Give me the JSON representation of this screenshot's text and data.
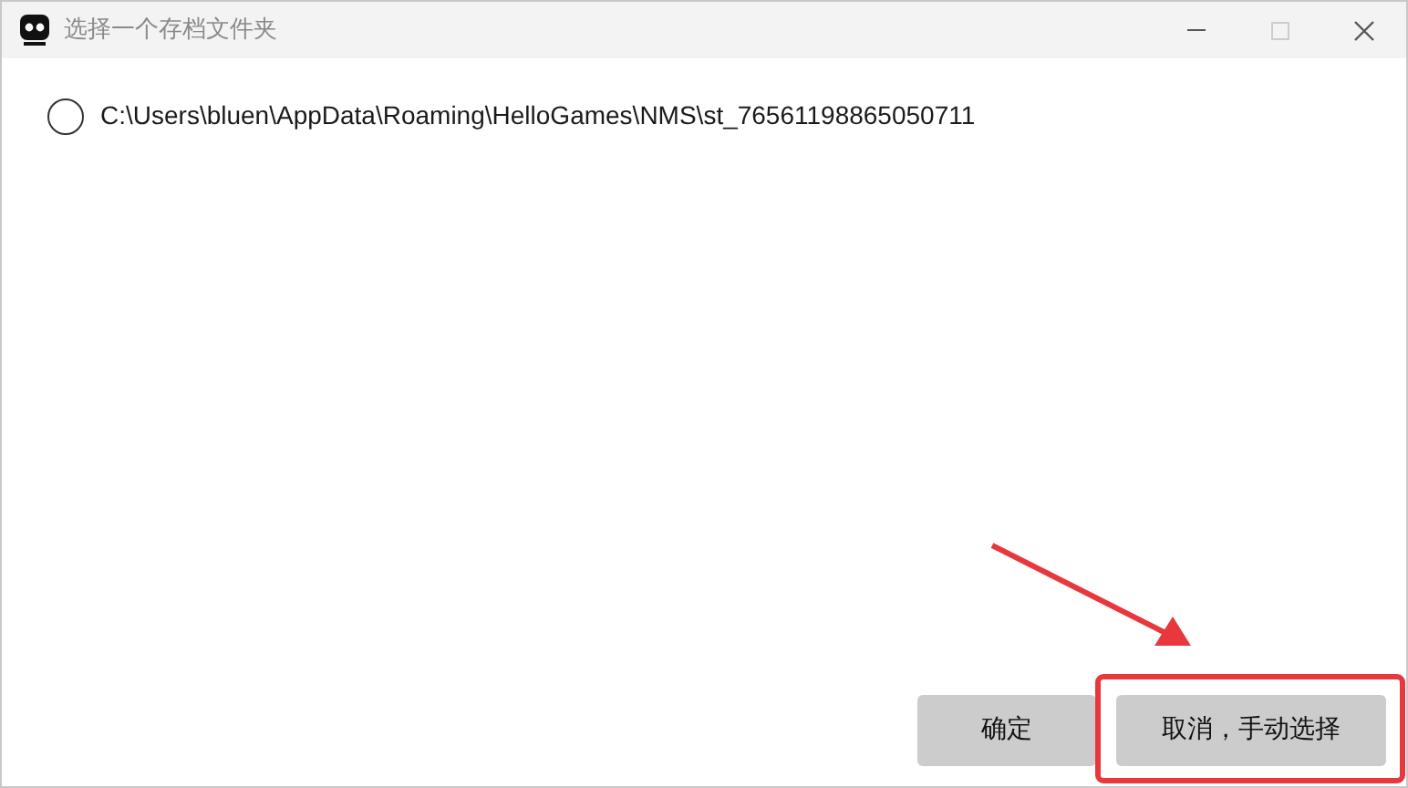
{
  "window": {
    "title": "选择一个存档文件夹"
  },
  "options": [
    {
      "label": "C:\\Users\\bluen\\AppData\\Roaming\\HelloGames\\NMS\\st_76561198865050711",
      "selected": false
    }
  ],
  "buttons": [
    {
      "label": "确定"
    },
    {
      "label": "取消，手动选择"
    }
  ]
}
